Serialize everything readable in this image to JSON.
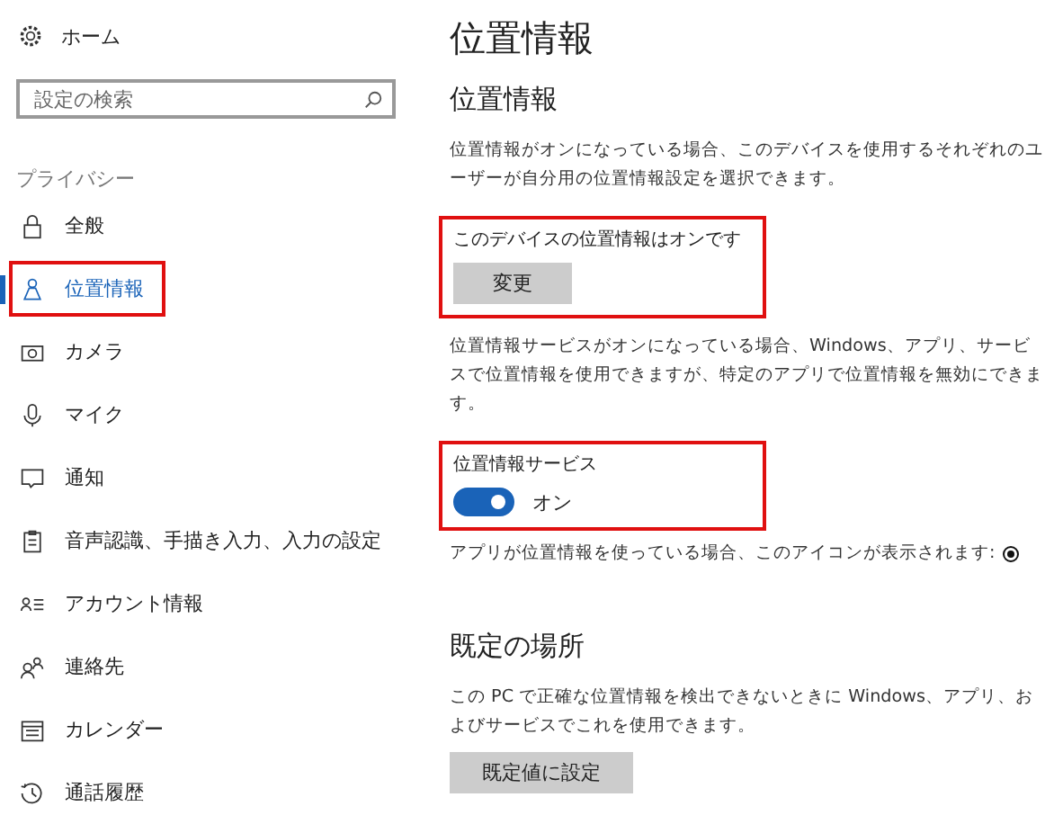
{
  "sidebar": {
    "home": "ホーム",
    "search": {
      "placeholder": "設定の検索"
    },
    "group": "プライバシー",
    "items": [
      {
        "label": "全般",
        "selected": false,
        "highlighted": false
      },
      {
        "label": "位置情報",
        "selected": true,
        "highlighted": true
      },
      {
        "label": "カメラ",
        "selected": false,
        "highlighted": false
      },
      {
        "label": "マイク",
        "selected": false,
        "highlighted": false
      },
      {
        "label": "通知",
        "selected": false,
        "highlighted": false
      },
      {
        "label": "音声認識、手描き入力、入力の設定",
        "selected": false,
        "highlighted": false
      },
      {
        "label": "アカウント情報",
        "selected": false,
        "highlighted": false
      },
      {
        "label": "連絡先",
        "selected": false,
        "highlighted": false
      },
      {
        "label": "カレンダー",
        "selected": false,
        "highlighted": false
      },
      {
        "label": "通話履歴",
        "selected": false,
        "highlighted": false
      }
    ]
  },
  "page": {
    "title": "位置情報",
    "location": {
      "heading": "位置情報",
      "description": "位置情報がオンになっている場合、このデバイスを使用するそれぞれのユーザーが自分用の位置情報設定を選択できます。",
      "device": {
        "highlighted": true,
        "status": "このデバイスの位置情報はオンです",
        "button": "変更"
      },
      "service_description": "位置情報サービスがオンになっている場合、Windows、アプリ、サービスで位置情報を使用できますが、特定のアプリで位置情報を無効にできます。",
      "service": {
        "highlighted": true,
        "label": "位置情報サービス",
        "on": true,
        "state_label": "オン"
      },
      "icon_note": "アプリが位置情報を使っている場合、このアイコンが表示されます:"
    },
    "default_location": {
      "heading": "既定の場所",
      "description": "この PC で正確な位置情報を検出できないときに Windows、アプリ、およびサービスでこれを使用できます。",
      "button": "既定値に設定"
    }
  }
}
